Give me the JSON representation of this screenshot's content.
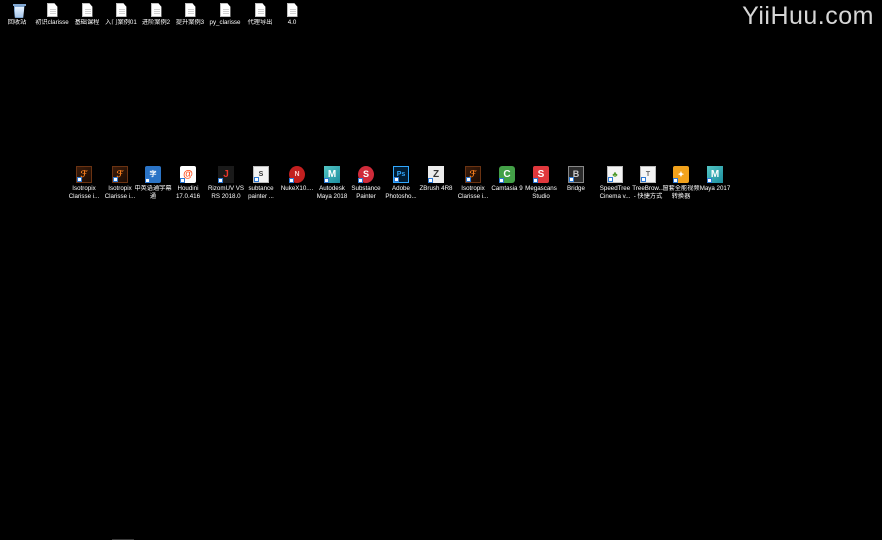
{
  "watermark": "YiiHuu.com",
  "desktop_top_row": [
    {
      "name": "desktop-icon-recycle-bin",
      "icon": "recycle-bin-icon",
      "glyph": "",
      "label": "回收站"
    },
    {
      "name": "desktop-icon-clarisse-intro",
      "icon": "document-icon",
      "glyph": "",
      "label": "初识clarisse"
    },
    {
      "name": "desktop-icon-basic-course",
      "icon": "document-icon",
      "glyph": "",
      "label": "基础课程"
    },
    {
      "name": "desktop-icon-intro-case-01",
      "icon": "document-icon",
      "glyph": "",
      "label": "入门案例01"
    },
    {
      "name": "desktop-icon-advanced-case-2",
      "icon": "document-icon",
      "glyph": "",
      "label": "进阶案例2"
    },
    {
      "name": "desktop-icon-improve-case-3",
      "icon": "document-icon",
      "glyph": "",
      "label": "提升案例3"
    },
    {
      "name": "desktop-icon-py-clarisse",
      "icon": "document-icon",
      "glyph": "",
      "label": "py_clarisse"
    },
    {
      "name": "desktop-icon-proxy-export",
      "icon": "document-icon",
      "glyph": "",
      "label": "代理导出"
    },
    {
      "name": "desktop-icon-4-0",
      "icon": "document-icon",
      "glyph": "",
      "label": "4.0"
    }
  ],
  "desktop_app_row": [
    {
      "name": "desktop-icon-isotropix-clarisse-1",
      "icon": "clarisse-icon",
      "glyph": "ℱ",
      "label": "Isotropix\nClarisse i..."
    },
    {
      "name": "desktop-icon-isotropix-clarisse-2",
      "icon": "clarisse-icon",
      "glyph": "ℱ",
      "label": "Isotropix\nClarisse i..."
    },
    {
      "name": "desktop-icon-chinese-subtitle",
      "icon": "subtitle-tool-icon",
      "glyph": "字",
      "label": "中英语通字幕\n通"
    },
    {
      "name": "desktop-icon-houdini",
      "icon": "houdini-icon",
      "glyph": "@",
      "label": "Houdini\n17.0.416"
    },
    {
      "name": "desktop-icon-rizomuv",
      "icon": "rizomuv-icon",
      "glyph": "J",
      "label": "RizomUV VS\nRS 2018.0"
    },
    {
      "name": "desktop-icon-substance-painter-doc",
      "icon": "substance-doc-icon",
      "glyph": "S",
      "label": "subtance\npainter ..."
    },
    {
      "name": "desktop-icon-nukex",
      "icon": "nuke-icon",
      "glyph": "N",
      "label": "NukeX10...."
    },
    {
      "name": "desktop-icon-autodesk-maya-2018",
      "icon": "maya-icon",
      "glyph": "M",
      "label": "Autodesk\nMaya 2018"
    },
    {
      "name": "desktop-icon-substance-painter",
      "icon": "substance-painter-icon",
      "glyph": "S",
      "label": "Substance\nPainter"
    },
    {
      "name": "desktop-icon-adobe-photoshop",
      "icon": "photoshop-icon",
      "glyph": "Ps",
      "label": "Adobe\nPhotosho..."
    },
    {
      "name": "desktop-icon-zbrush",
      "icon": "zbrush-icon",
      "glyph": "Z",
      "label": "ZBrush 4R8"
    },
    {
      "name": "desktop-icon-isotropix-clarisse-3",
      "icon": "clarisse-icon",
      "glyph": "ℱ",
      "label": "Isotropix\nClarisse i..."
    },
    {
      "name": "desktop-icon-camtasia",
      "icon": "camtasia-icon",
      "glyph": "C",
      "label": "Camtasia 9"
    },
    {
      "name": "desktop-icon-megascans-studio",
      "icon": "megascans-icon",
      "glyph": "S",
      "label": "Megascans\nStudio"
    },
    {
      "name": "desktop-icon-bridge",
      "icon": "bridge-icon",
      "glyph": "B",
      "label": "Bridge"
    },
    {
      "name": "desktop-icon-speedtree",
      "icon": "speedtree-icon",
      "glyph": "♣",
      "label": "SpeedTree\nCinema v..."
    },
    {
      "name": "desktop-icon-treebrowser",
      "icon": "treebrowser-icon",
      "glyph": "T",
      "label": "TreeBrow...\n- 快捷方式"
    },
    {
      "name": "desktop-icon-pixel-art-video",
      "icon": "pixel-video-icon",
      "glyph": "✦",
      "label": "窗套全能视频\n转换器"
    },
    {
      "name": "desktop-icon-maya-2017",
      "icon": "maya-icon",
      "glyph": "M",
      "label": "Maya 2017"
    }
  ]
}
